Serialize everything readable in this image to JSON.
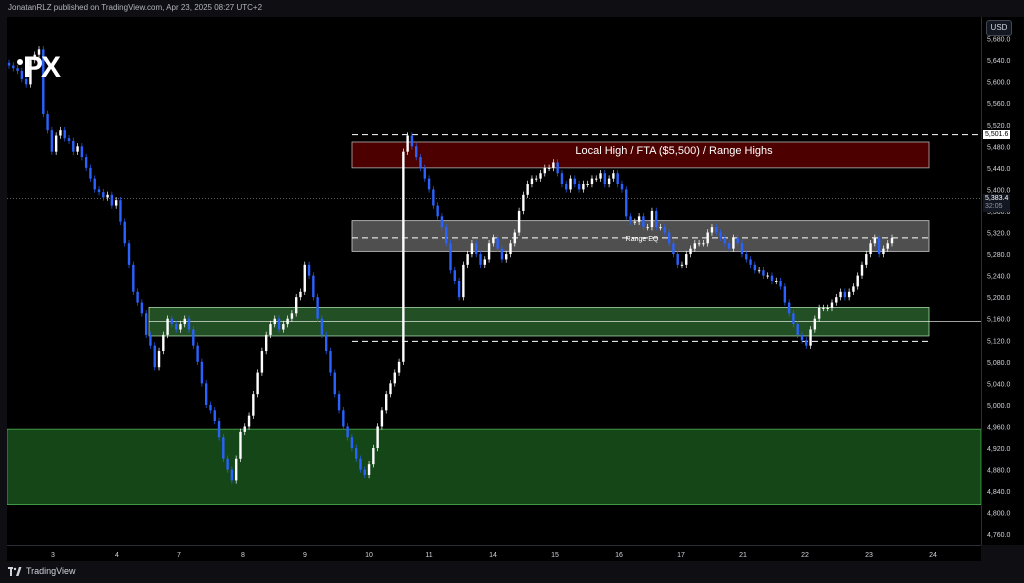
{
  "header": {
    "published_text": "JonatanRLZ published on TradingView.com, Apr 23, 2025 08:27 UTC+2"
  },
  "brand": {
    "logo_text": "PX",
    "footer_text": "TradingView"
  },
  "axis": {
    "currency_label": "USD"
  },
  "price_tags": {
    "range_top": "5,501.6",
    "last_price": "5,383.4",
    "countdown": "32:05"
  },
  "annotations": {
    "zone_label": "Local High / FTA ($5,500) / Range Highs",
    "eq_label": "Range EQ"
  },
  "colors": {
    "background": "#000000",
    "candle_up": "#ffffff",
    "candle_down": "#2962ff",
    "supply_zone": "#b71c1c",
    "demand_zone": "#1b5e20",
    "range_zone": "#9e9e9e"
  },
  "chart_data": {
    "type": "candlestick",
    "title": "",
    "xlabel": "",
    "ylabel": "",
    "ylim": [
      4740,
      5720
    ],
    "y_ticks": [
      "5,680.0",
      "5,640.0",
      "5,600.0",
      "5,560.0",
      "5,520.0",
      "5,480.0",
      "5,440.0",
      "5,400.0",
      "5,360.0",
      "5,320.0",
      "5,280.0",
      "5,240.0",
      "5,200.0",
      "5,160.0",
      "5,120.0",
      "5,080.0",
      "5,040.0",
      "5,000.0",
      "4,960.0",
      "4,920.0",
      "4,880.0",
      "4,840.0",
      "4,800.0",
      "4,760.0"
    ],
    "x_ticks": [
      "3",
      "4",
      "7",
      "8",
      "9",
      "10",
      "11",
      "14",
      "15",
      "16",
      "17",
      "21",
      "22",
      "23",
      "24"
    ],
    "series": [
      {
        "values": [
          5630,
          5625,
          5620,
          5605,
          5595,
          5640,
          5650,
          5660,
          5540,
          5510,
          5470,
          5500,
          5510,
          5495,
          5490,
          5470,
          5480,
          5460,
          5440,
          5420,
          5400,
          5395,
          5385,
          5390,
          5370,
          5380,
          5340,
          5300,
          5260,
          5210,
          5190,
          5170,
          5130,
          5110,
          5070,
          5100,
          5130,
          5160,
          5150,
          5140,
          5150,
          5160,
          5140,
          5110,
          5080,
          5040,
          5000,
          4990,
          4970,
          4940,
          4900,
          4880,
          4860,
          4900,
          4950,
          4960,
          4980,
          5020,
          5060,
          5100,
          5130,
          5150,
          5160,
          5140,
          5150,
          5160,
          5170,
          5200,
          5210,
          5260,
          5240,
          5200,
          5160,
          5130,
          5100,
          5060,
          5020,
          4990,
          4960,
          4940,
          4920,
          4900,
          4880,
          4870,
          4890,
          4920,
          4960,
          4990,
          5020,
          5040,
          5060,
          5080,
          5470,
          5500,
          5480,
          5460,
          5440,
          5420,
          5400,
          5370,
          5350,
          5330,
          5300,
          5250,
          5230,
          5200,
          5260,
          5280,
          5300,
          5280,
          5260,
          5270,
          5300,
          5310,
          5290,
          5270,
          5280,
          5300,
          5320,
          5360,
          5390,
          5410,
          5420,
          5420,
          5430,
          5440,
          5440,
          5450,
          5430,
          5410,
          5400,
          5420,
          5410,
          5400,
          5410,
          5410,
          5420,
          5420,
          5430,
          5410,
          5420,
          5430,
          5410,
          5400,
          5350,
          5340,
          5340,
          5350,
          5330,
          5330,
          5360,
          5330,
          5330,
          5320,
          5300,
          5280,
          5260,
          5260,
          5280,
          5290,
          5300,
          5300,
          5300,
          5320,
          5330,
          5320,
          5310,
          5300,
          5290,
          5310,
          5300,
          5280,
          5270,
          5260,
          5250,
          5250,
          5240,
          5240,
          5230,
          5230,
          5220,
          5190,
          5170,
          5150,
          5130,
          5120,
          5110,
          5140,
          5160,
          5180,
          5180,
          5180,
          5190,
          5200,
          5210,
          5200,
          5210,
          5220,
          5240,
          5260,
          5280,
          5300,
          5310,
          5280,
          5290,
          5300,
          5310
        ]
      }
    ],
    "levels": {
      "supply_zone": [
        5440,
        5488
      ],
      "range_zone": [
        5285,
        5342
      ],
      "range_eq": 5310,
      "demand_zone": [
        5128,
        5181
      ],
      "lower_demand_zone": [
        4815,
        4955
      ],
      "range_top_line": 5501.6,
      "range_bottom_line": 5118,
      "last_price": 5383.4
    }
  }
}
